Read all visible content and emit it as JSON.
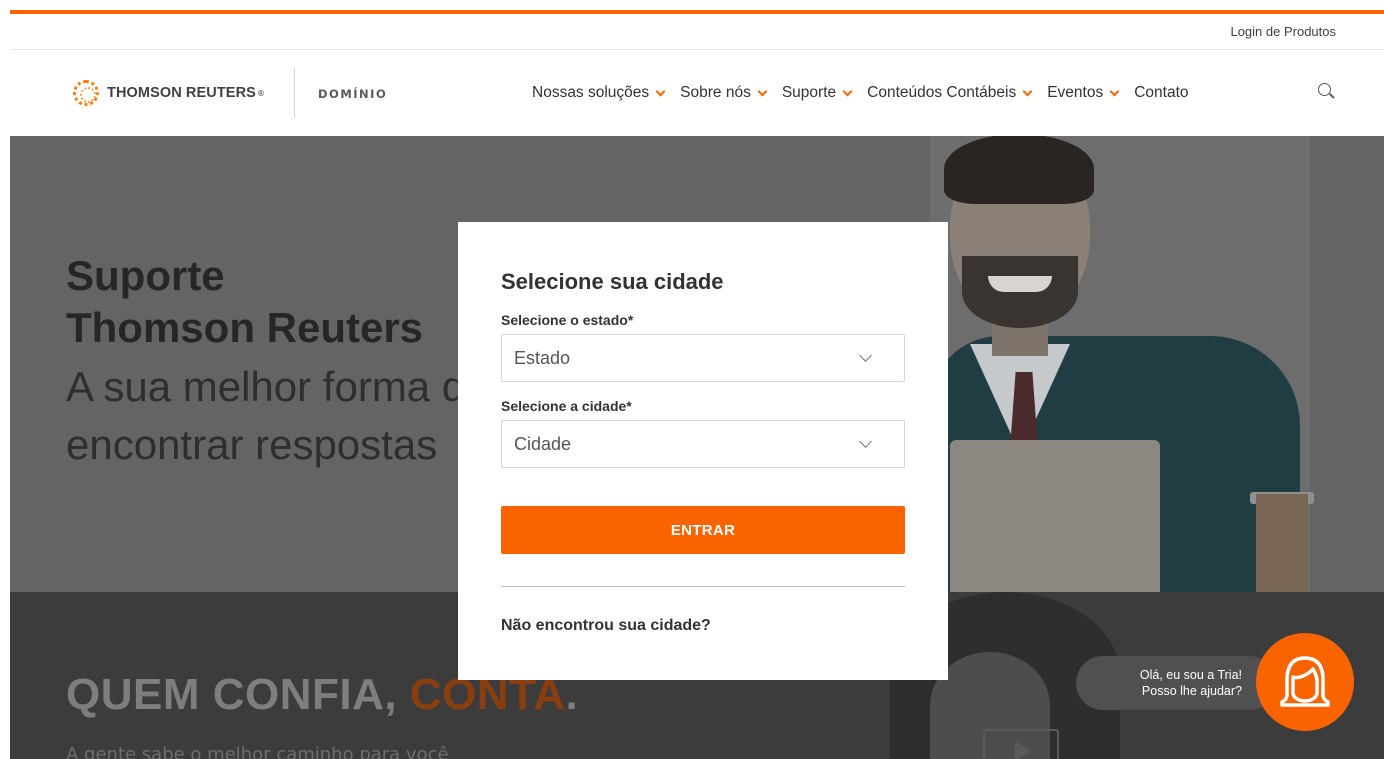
{
  "topbar": {
    "login_label": "Login de Produtos"
  },
  "brand": {
    "logo_text": "THOMSON REUTERS",
    "logo_mark": "®",
    "product": "DOMÍNIO"
  },
  "nav": {
    "items": [
      {
        "label": "Nossas soluções",
        "has_dropdown": true
      },
      {
        "label": "Sobre nós",
        "has_dropdown": true
      },
      {
        "label": "Suporte",
        "has_dropdown": true
      },
      {
        "label": "Conteúdos Contábeis",
        "has_dropdown": true
      },
      {
        "label": "Eventos",
        "has_dropdown": true
      },
      {
        "label": "Contato",
        "has_dropdown": false
      }
    ],
    "search_icon": "search-icon"
  },
  "hero": {
    "title_line1": "Suporte",
    "title_line2": "Thomson Reuters",
    "tagline_line1": "A sua melhor forma de",
    "tagline_line2": "encontrar respostas"
  },
  "band": {
    "title_part1": "QUEM CONFIA, ",
    "title_accent": "CONTA",
    "title_end": ".",
    "subtitle": "A gente sabe o melhor caminho para você"
  },
  "modal": {
    "title": "Selecione sua cidade",
    "state_label": "Selecione o estado*",
    "state_value": "Estado",
    "city_label": "Selecione a cidade*",
    "city_value": "Cidade",
    "submit_label": "ENTRAR",
    "not_found": "Não encontrou sua cidade?"
  },
  "chat": {
    "line1": "Olá, eu sou a Tria!",
    "line2": "Posso lhe ajudar?"
  },
  "colors": {
    "accent": "#fa6400",
    "text": "#333333",
    "overlay_hero": "#646464",
    "overlay_band": "#3c3c3c"
  }
}
